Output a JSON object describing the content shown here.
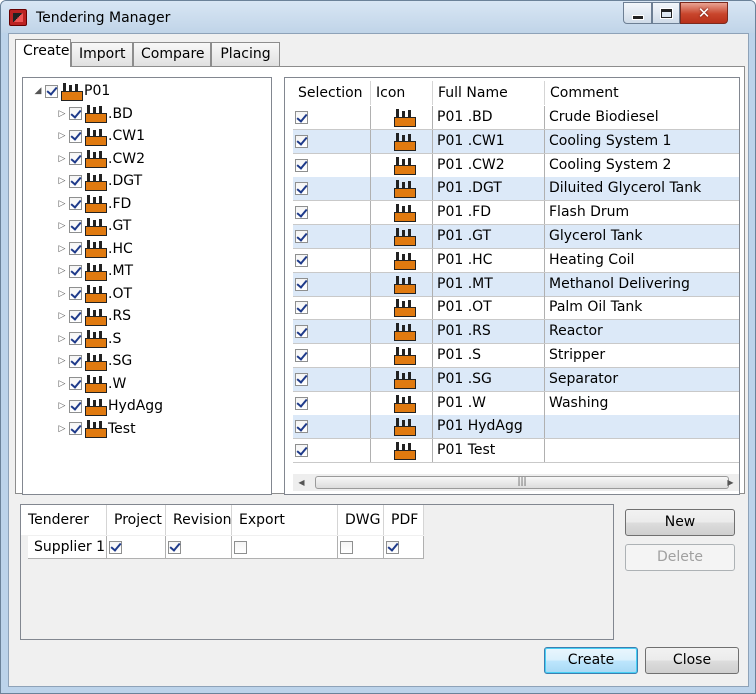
{
  "window": {
    "title": "Tendering Manager"
  },
  "tabs": [
    "Create",
    "Import",
    "Compare",
    "Placing"
  ],
  "tree": {
    "root": "P01",
    "children": [
      ".BD",
      ".CW1",
      ".CW2",
      ".DGT",
      ".FD",
      ".GT",
      ".HC",
      ".MT",
      ".OT",
      ".RS",
      ".S",
      ".SG",
      ".W",
      "HydAgg",
      "Test"
    ]
  },
  "grid": {
    "columns": [
      "Selection",
      "Icon",
      "Full Name",
      "Comment"
    ],
    "rows": [
      {
        "full_name": "P01 .BD",
        "comment": "Crude Biodiesel"
      },
      {
        "full_name": "P01 .CW1",
        "comment": "Cooling System 1"
      },
      {
        "full_name": "P01 .CW2",
        "comment": "Cooling System 2"
      },
      {
        "full_name": "P01 .DGT",
        "comment": "Diluited Glycerol Tank"
      },
      {
        "full_name": "P01 .FD",
        "comment": "Flash Drum"
      },
      {
        "full_name": "P01 .GT",
        "comment": "Glycerol Tank"
      },
      {
        "full_name": "P01 .HC",
        "comment": "Heating Coil"
      },
      {
        "full_name": "P01 .MT",
        "comment": "Methanol Delivering"
      },
      {
        "full_name": "P01 .OT",
        "comment": "Palm Oil Tank"
      },
      {
        "full_name": "P01 .RS",
        "comment": "Reactor"
      },
      {
        "full_name": "P01 .S",
        "comment": "Stripper"
      },
      {
        "full_name": "P01 .SG",
        "comment": "Separator"
      },
      {
        "full_name": "P01 .W",
        "comment": "Washing"
      },
      {
        "full_name": "P01 HydAgg",
        "comment": ""
      },
      {
        "full_name": "P01 Test",
        "comment": ""
      }
    ]
  },
  "tenderers": {
    "columns": [
      "Tenderer",
      "Project",
      "Revision",
      "Export Project",
      "DWG",
      "PDF"
    ],
    "rows": [
      {
        "tenderer": "Supplier 1",
        "project": true,
        "revision": true,
        "export_project": false,
        "dwg": false,
        "pdf": true
      }
    ]
  },
  "buttons": {
    "new": "New",
    "delete": "Delete",
    "create": "Create",
    "close": "Close"
  },
  "icons": {
    "item": "factory-icon",
    "window_close": "close-icon",
    "window_min": "minimize-icon",
    "window_max": "maximize-icon"
  }
}
